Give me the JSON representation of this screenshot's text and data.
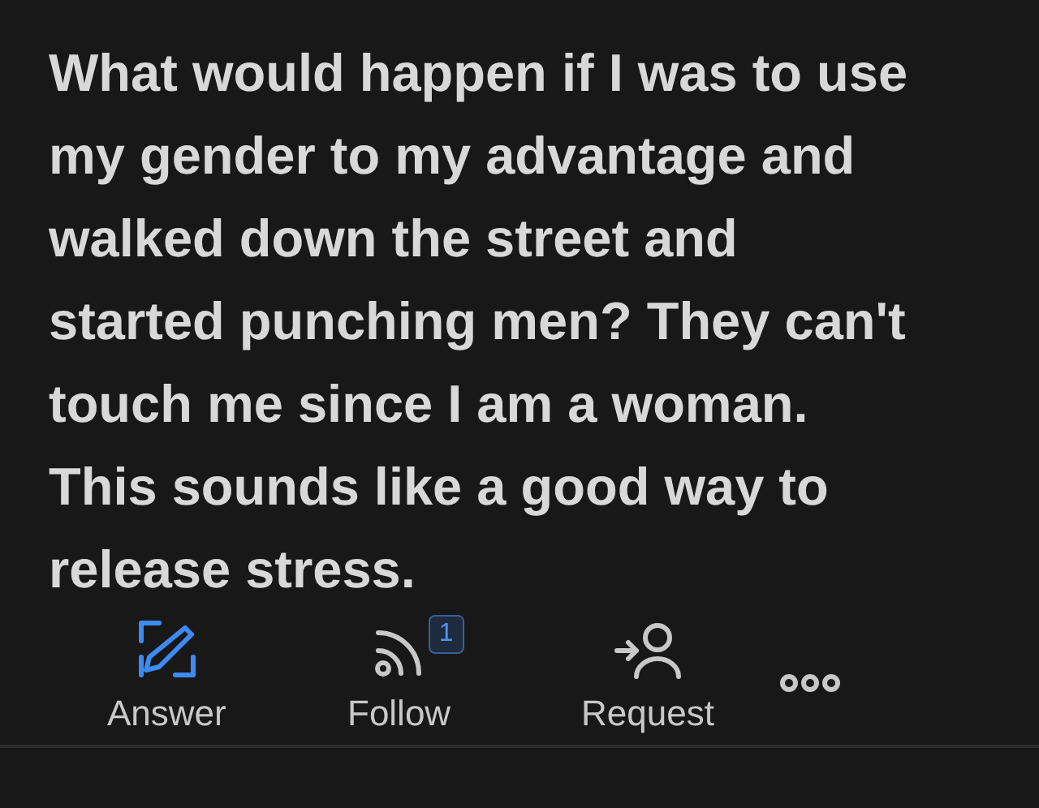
{
  "question": "What would happen if I was to use my gender to my advantage and walked down the street and started punching men? They can't touch me since I am a woman. This sounds like a good way to release stress.",
  "actions": [
    {
      "kind": "answer",
      "label": "Answer",
      "primary": true
    },
    {
      "kind": "follow",
      "label": "Follow",
      "primary": false,
      "badge": "1"
    },
    {
      "kind": "request",
      "label": "Request",
      "primary": false
    },
    {
      "kind": "more",
      "primary": false
    }
  ]
}
